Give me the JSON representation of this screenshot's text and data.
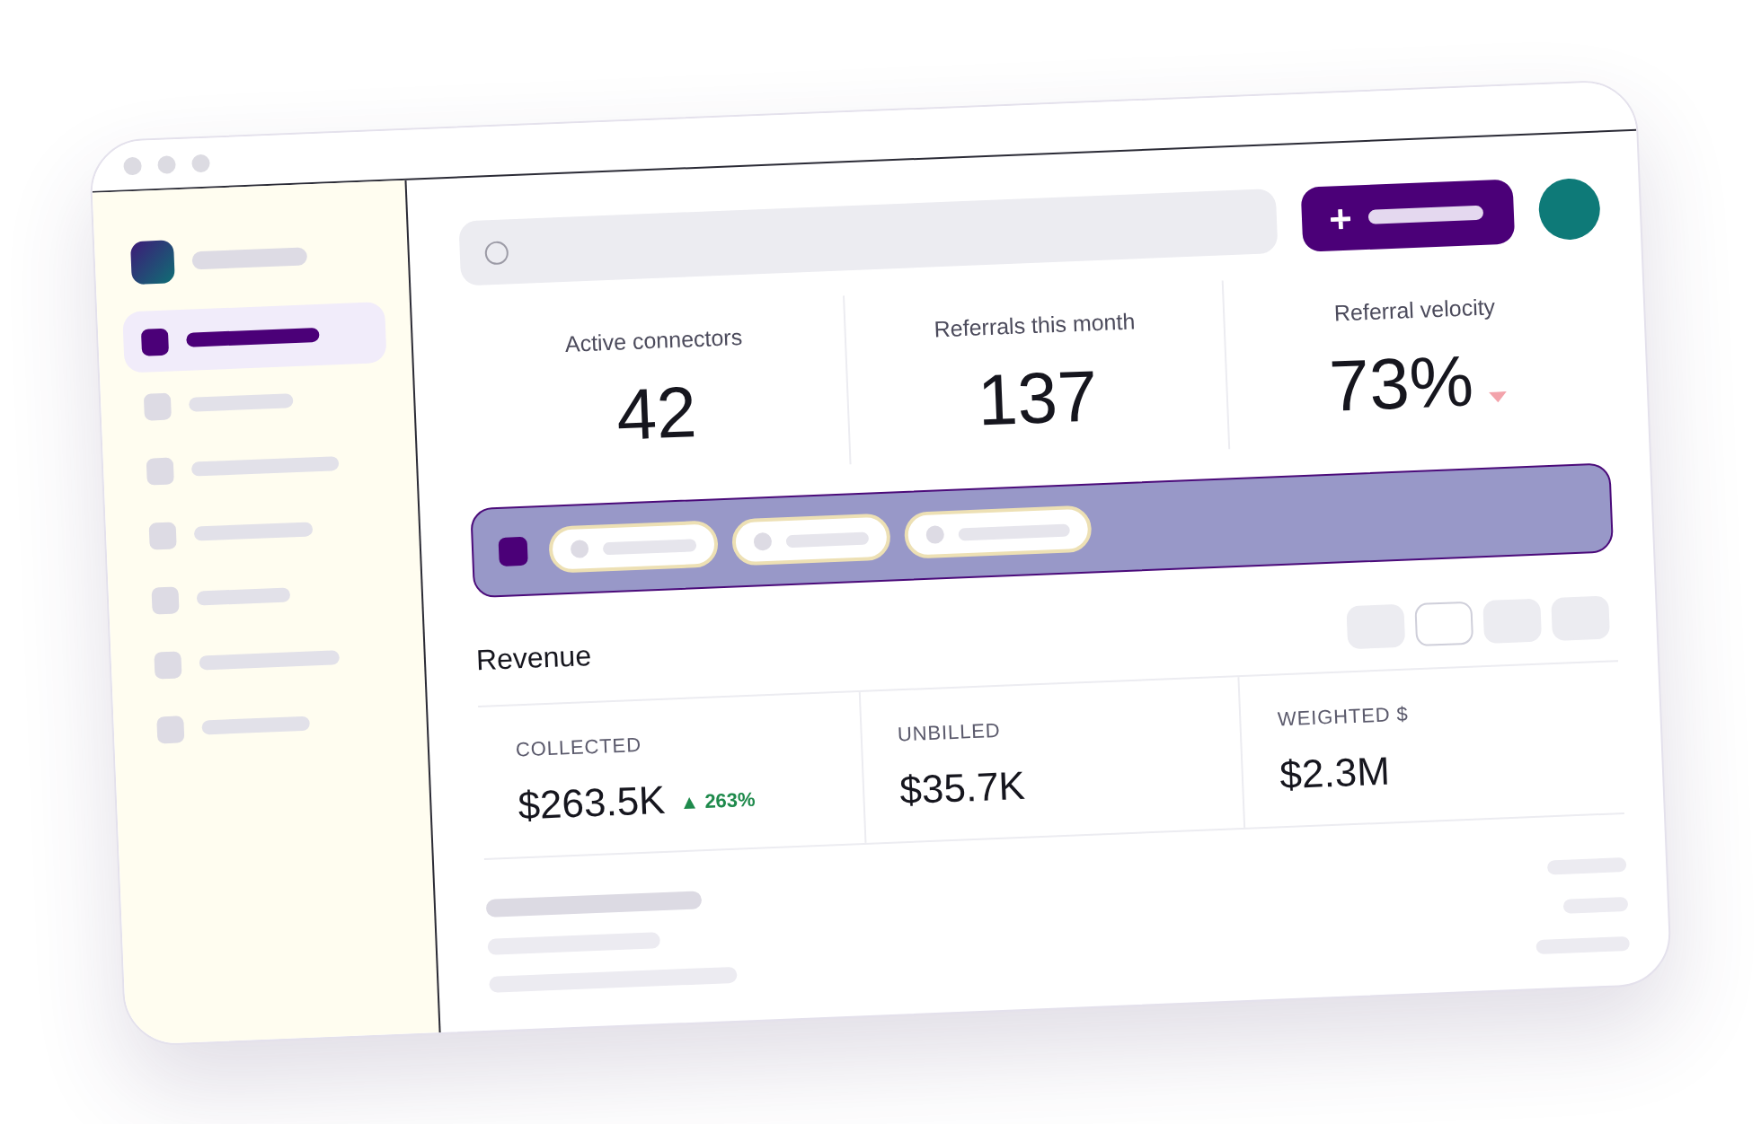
{
  "sidebar": {
    "items": [
      {
        "selected": true
      },
      {
        "selected": false
      },
      {
        "selected": false
      },
      {
        "selected": false
      },
      {
        "selected": false
      },
      {
        "selected": false
      },
      {
        "selected": false
      }
    ]
  },
  "stats": [
    {
      "label": "Active connectors",
      "value": "42",
      "declining": false
    },
    {
      "label": "Referrals this month",
      "value": "137",
      "declining": false
    },
    {
      "label": "Referral velocity",
      "value": "73%",
      "declining": true
    }
  ],
  "revenue": {
    "title": "Revenue",
    "views": [
      {
        "selected": false
      },
      {
        "selected": true
      },
      {
        "selected": false
      },
      {
        "selected": false
      }
    ],
    "cards": [
      {
        "label": "COLLECTED",
        "value": "$263.5K",
        "change": "▲ 263%",
        "positive": true
      },
      {
        "label": "UNBILLED",
        "value": "$35.7K"
      },
      {
        "label": "WEIGHTED $",
        "value": "$2.3M"
      }
    ]
  }
}
